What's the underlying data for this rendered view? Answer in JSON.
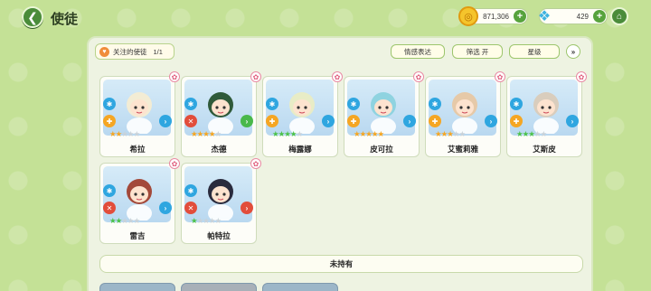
{
  "header": {
    "title": "使徒",
    "gold": "871,306",
    "gems": "429"
  },
  "panel": {
    "favorite_label": "关注的使徒",
    "favorite_count": "1/1",
    "emotion_button": "情感表达",
    "filter_button": "筛选 开",
    "star_button": "星级",
    "not_owned_label": "未持有"
  },
  "colors": {
    "background": "#c4e196",
    "accent_green": "#4a8c3a",
    "star_orange": "#f5a623",
    "star_green": "#4cc24a",
    "star_empty": "#c9d2d9"
  },
  "characters": [
    {
      "name": "希拉",
      "stars": 2,
      "star_color": "orange",
      "element": "blue",
      "role": "orange",
      "arrow": "blue"
    },
    {
      "name": "杰德",
      "stars": 4,
      "star_color": "orange",
      "element": "blue",
      "role": "red",
      "arrow": "green"
    },
    {
      "name": "梅露娜",
      "stars": 4,
      "star_color": "green",
      "element": "blue",
      "role": "orange",
      "arrow": "blue"
    },
    {
      "name": "皮可拉",
      "stars": 5,
      "star_color": "orange",
      "element": "blue",
      "role": "orange",
      "arrow": "blue"
    },
    {
      "name": "艾蜜莉雅",
      "stars": 3,
      "star_color": "orange",
      "element": "blue",
      "role": "orange",
      "arrow": "blue"
    },
    {
      "name": "艾斯皮",
      "stars": 3,
      "star_color": "green",
      "element": "blue",
      "role": "orange",
      "arrow": "blue"
    },
    {
      "name": "雷吉",
      "stars": 2,
      "star_color": "green",
      "element": "blue",
      "role": "red",
      "arrow": "blue"
    },
    {
      "name": "帕特拉",
      "stars": 1,
      "star_color": "green",
      "element": "blue",
      "role": "red",
      "arrow": "red"
    }
  ]
}
